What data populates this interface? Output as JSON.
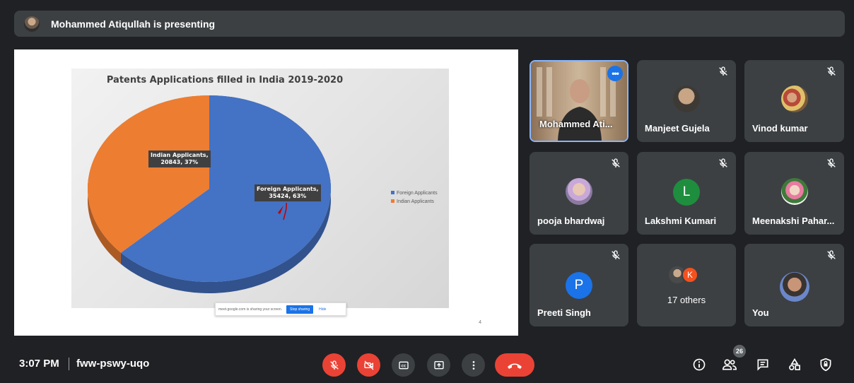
{
  "banner": {
    "text": "Mohammed Atiqullah is presenting"
  },
  "slide": {
    "page_number": "4",
    "share_bar": {
      "text": "meet.google.com is sharing your screen.",
      "stop_label": "Stop sharing",
      "hide_label": "Hide"
    }
  },
  "chart_data": {
    "type": "pie",
    "title": "Patents Applications filled in India 2019-2020",
    "categories": [
      "Foreign Applicants",
      "Indian Applicants"
    ],
    "values": [
      35424,
      20843
    ],
    "percentages": [
      63,
      37
    ],
    "colors": [
      "#4472c4",
      "#ed7d31"
    ],
    "data_labels": [
      {
        "line1": "Foreign Applicants,",
        "line2": "35424, 63%"
      },
      {
        "line1": "Indian Applicants,",
        "line2": "20843, 37%"
      }
    ],
    "legend": [
      "Foreign Applicants",
      "Indian Applicants"
    ],
    "legend_position": "right"
  },
  "participants": [
    {
      "name": "Mohammed Ati...",
      "video": true,
      "more": "•••"
    },
    {
      "name": "Manjeet Gujela",
      "muted": true
    },
    {
      "name": "Vinod kumar",
      "muted": true
    },
    {
      "name": "pooja bhardwaj",
      "muted": true
    },
    {
      "name": "Lakshmi Kumari",
      "muted": true,
      "initial": "L",
      "color": "#1e8e3e"
    },
    {
      "name": "Meenakshi Pahar...",
      "muted": true
    },
    {
      "name": "Preeti Singh",
      "muted": true,
      "initial": "P",
      "color": "#1a73e8"
    },
    {
      "name": "17 others",
      "initial": "K",
      "color": "#f4511e"
    },
    {
      "name": "You",
      "muted": true
    }
  ],
  "bottom_bar": {
    "time": "3:07 PM",
    "meeting_code": "fww-pswy-uqo",
    "people_count": "26"
  },
  "icons": [
    "mic-off-icon",
    "camera-off-icon",
    "captions-icon",
    "present-icon",
    "more-vert-icon",
    "end-call-icon",
    "info-icon",
    "people-icon",
    "chat-icon",
    "activities-icon",
    "host-controls-icon"
  ]
}
